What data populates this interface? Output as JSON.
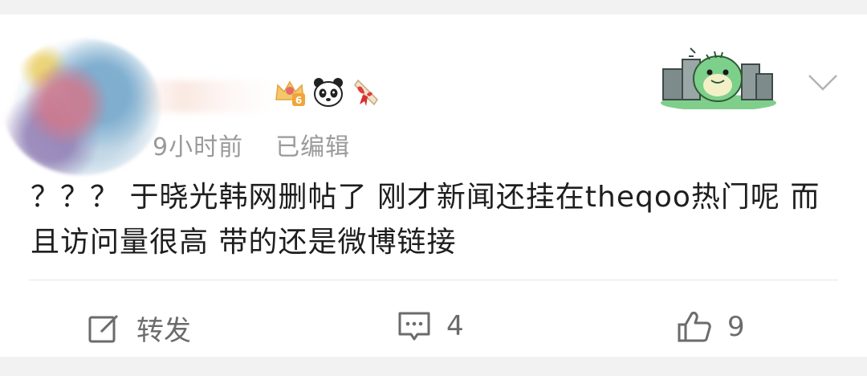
{
  "post": {
    "time": "9小时前",
    "edited": "已编辑",
    "text": "？？？ 于晓光韩网删帖了 刚才新闻还挂在theqoo热门呢 而且访问量很高 带的还是微博链接"
  },
  "badges": [
    {
      "icon": "crown-level-badge-icon",
      "level": "6"
    },
    {
      "icon": "panda-icon"
    },
    {
      "icon": "ribbon-gift-icon"
    }
  ],
  "actions": {
    "repost_label": "转发",
    "comments_count": "4",
    "likes_count": "9"
  },
  "colors": {
    "text_primary": "#1e1e1e",
    "text_secondary": "#9a9a9a",
    "action_gray": "#6b6b6b",
    "background": "#f2f2f2"
  }
}
